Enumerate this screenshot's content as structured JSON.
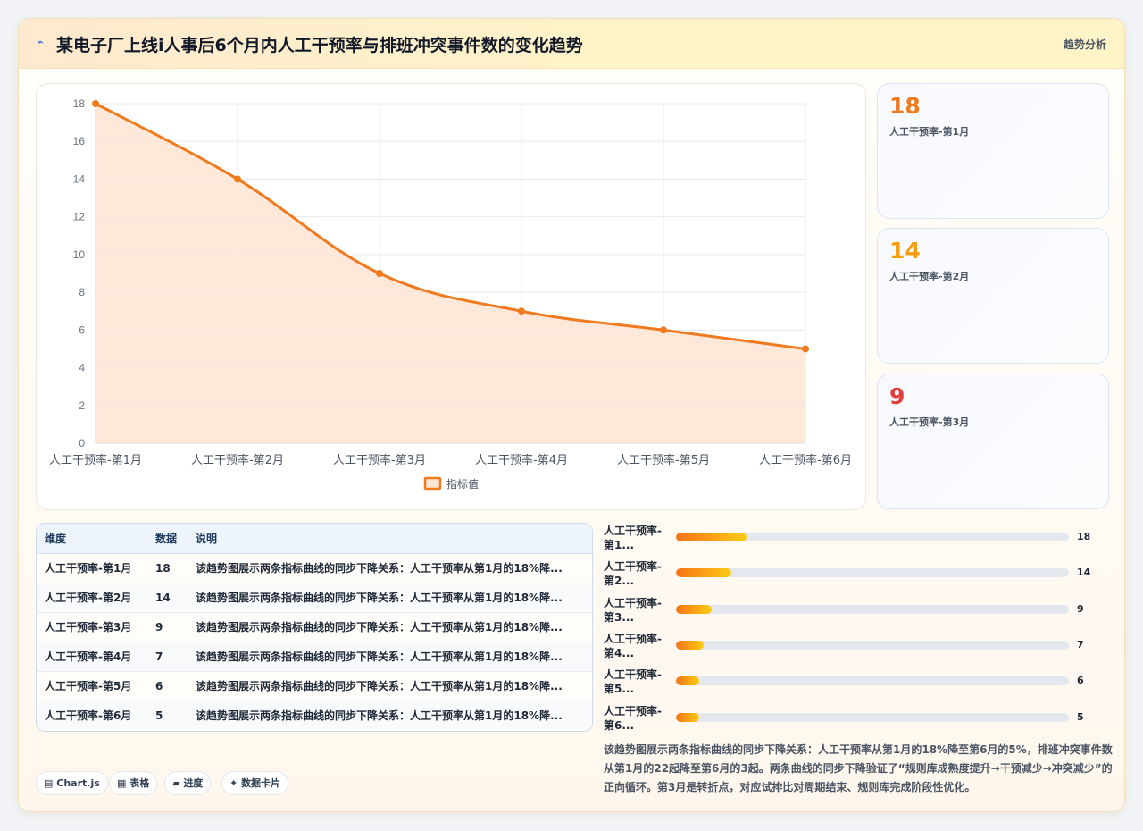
{
  "header": {
    "icon": "trend-icon",
    "title": "某电子厂上线i人事后6个月内人工干预率与排班冲突事件数的变化趋势",
    "right_label": "趋势分析"
  },
  "chart_data": {
    "type": "line",
    "categories": [
      "人工干预率-第1月",
      "人工干预率-第2月",
      "人工干预率-第3月",
      "人工干预率-第4月",
      "人工干预率-第5月",
      "人工干预率-第6月"
    ],
    "series": [
      {
        "name": "指标值",
        "values": [
          18,
          14,
          9,
          7,
          6,
          5
        ],
        "color": "#f07a1e",
        "fill": "#fde5d6"
      }
    ],
    "ylim": [
      0,
      18
    ],
    "yticks": [
      0,
      2,
      4,
      6,
      8,
      10,
      12,
      14,
      16,
      18
    ],
    "grid": true,
    "legend_position": "bottom"
  },
  "stats": [
    {
      "value": "18",
      "label": "人工干预率-第1月",
      "color": "#f07a1e"
    },
    {
      "value": "14",
      "label": "人工干预率-第2月",
      "color": "#f59e0b"
    },
    {
      "value": "9",
      "label": "人工干预率-第3月",
      "color": "#e53e3e"
    }
  ],
  "table": {
    "headers": [
      "维度",
      "数据",
      "说明"
    ],
    "rows": [
      [
        "人工干预率-第1月",
        "18",
        "该趋势图展示两条指标曲线的同步下降关系：人工干预率从第1月的18%降..."
      ],
      [
        "人工干预率-第2月",
        "14",
        "该趋势图展示两条指标曲线的同步下降关系：人工干预率从第1月的18%降..."
      ],
      [
        "人工干预率-第3月",
        "9",
        "该趋势图展示两条指标曲线的同步下降关系：人工干预率从第1月的18%降..."
      ],
      [
        "人工干预率-第4月",
        "7",
        "该趋势图展示两条指标曲线的同步下降关系：人工干预率从第1月的18%降..."
      ],
      [
        "人工干预率-第5月",
        "6",
        "该趋势图展示两条指标曲线的同步下降关系：人工干预率从第1月的18%降..."
      ],
      [
        "人工干预率-第6月",
        "5",
        "该趋势图展示两条指标曲线的同步下降关系：人工干预率从第1月的18%降..."
      ]
    ]
  },
  "progress": {
    "max": 100,
    "items": [
      {
        "label": "人工干预率-第1...",
        "value": 18
      },
      {
        "label": "人工干预率-第2...",
        "value": 14
      },
      {
        "label": "人工干预率-第3...",
        "value": 9
      },
      {
        "label": "人工干预率-第4...",
        "value": 7
      },
      {
        "label": "人工干预率-第5...",
        "value": 6
      },
      {
        "label": "人工干预率-第6...",
        "value": 5
      }
    ]
  },
  "description": "该趋势图展示两条指标曲线的同步下降关系：人工干预率从第1月的18%降至第6月的5%，排班冲突事件数从第1月的22起降至第6月的3起。两条曲线的同步下降验证了“规则库成熟度提升→干预减少→冲突减少”的正向循环。第3月是转折点，对应试排比对周期结束、规则库完成阶段性优化。",
  "tags": [
    {
      "icon": "▤",
      "label": "Chart.js"
    },
    {
      "icon": "▦",
      "label": "表格"
    },
    {
      "icon": "▰",
      "label": "进度"
    },
    {
      "icon": "✦",
      "label": "数据卡片"
    }
  ]
}
